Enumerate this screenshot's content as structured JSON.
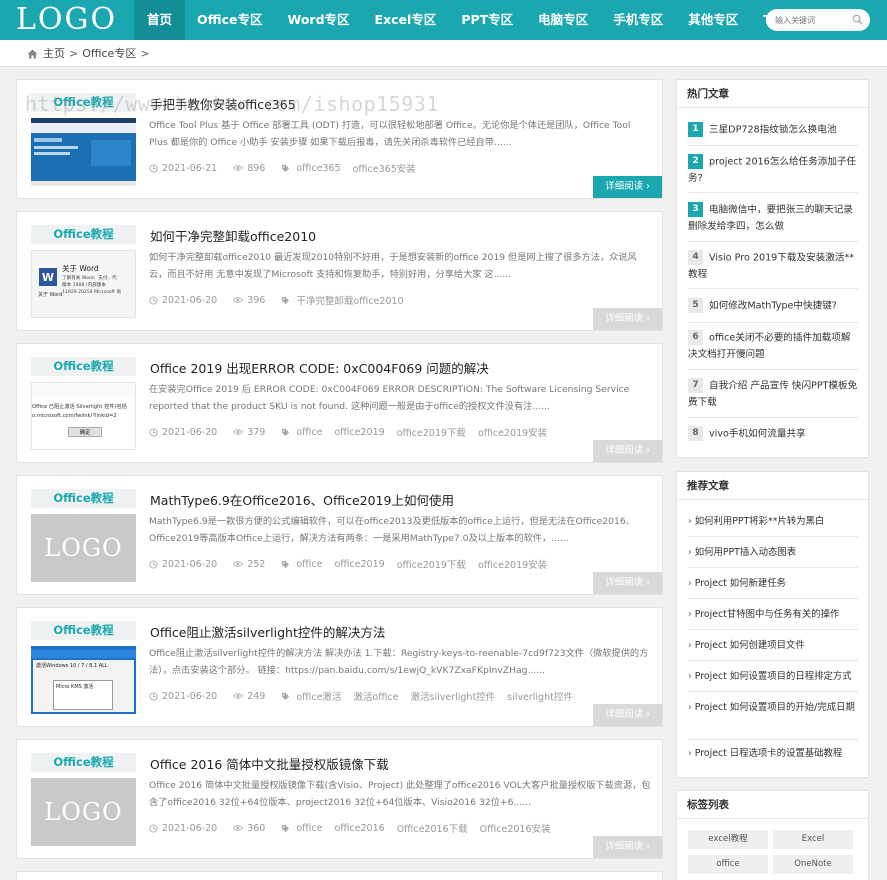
{
  "nav": {
    "logo": "LOGO",
    "items": [
      "首页",
      "Office专区",
      "Word专区",
      "Excel专区",
      "PPT专区",
      "电脑专区",
      "手机专区",
      "其他专区",
      "Tag标签"
    ],
    "search_placeholder": "输入关键词"
  },
  "breadcrumb": {
    "home": "主页",
    "sep": ">",
    "current": "Office专区"
  },
  "watermark": "https://www.huzhan.com/ishop15931",
  "articles": [
    {
      "category": "Office教程",
      "title": "手把手教你安装office365",
      "excerpt": "Office Tool Plus 基于 Office 部署工具 (ODT) 打造，可以很轻松地部署 Office。无论你是个体还是团队，Office Tool Plus 都是你的 Office 小助手 安装步骤 如果下载后报毒，请先关闭杀毒软件已经自带......",
      "date": "2021-06-21",
      "views": "896",
      "tags": [
        "office365",
        "office365安装"
      ],
      "more": "详细阅读"
    },
    {
      "category": "Office教程",
      "title": "如何干净完整卸载office2010",
      "excerpt": "如何干净完整卸载office2010 最近发现2010特别不好用，于是想安装新的office 2019 但是网上搜了很多方法，众说风云，而且不好用 无意中发现了Microsoft 支持和恢复助手，特别好用，分享给大家 这......",
      "date": "2021-06-20",
      "views": "396",
      "tags": [
        "干净完整卸载office2010"
      ],
      "more": "详细阅读",
      "thumb_title": "关于 Word",
      "thumb_lines": [
        "了解有关 Word、支付、代",
        "版本 1908 (内部版本",
        "11929.20254 Microsoft 商"
      ],
      "thumb_caption": "关于 Word"
    },
    {
      "category": "Office教程",
      "title": "Office 2019 出现ERROR CODE: 0xC004F069 问题的解决",
      "excerpt": "在安装完Office 2019 后 ERROR CODE: 0xC004F069 ERROR DESCRIPTION: The Software Licensing Service reported that the product SKU is not found. 这种问题一般是由于office的授权文件没有注......",
      "date": "2021-06-20",
      "views": "379",
      "tags": [
        "office",
        "office2019",
        "office2019下载",
        "office2019安装"
      ],
      "more": "详细阅读",
      "thumb_lines": [
        "Office 已阻止激活 Silverlight 控件(包括",
        "o.microsoft.com/fwlink/?linkid=2"
      ],
      "thumb_button": "确定"
    },
    {
      "category": "Office教程",
      "title": "MathType6.9在Office2016、Office2019上如何使用",
      "excerpt": "MathType6.9是一款很方便的公式编辑软件，可以在office2013及更低版本的office上运行，但是无法在Office2016、Office2019等高版本Office上运行，解决方法有两条：一是采用MathType7.0及以上版本的软件，......",
      "date": "2021-06-20",
      "views": "252",
      "tags": [
        "office",
        "office2019",
        "office2019下载",
        "office2019安装"
      ],
      "more": "详细阅读",
      "thumb_logo": "LOGO"
    },
    {
      "category": "Office教程",
      "title": "Office阻止激活silverlight控件的解决方法",
      "excerpt": "Office阻止激活silverlight控件的解决方法 解决办法 1.下载：Registry-keys-to-reenable-7cd9f723文件（微软提供的方法），点击安装这个部分。 链接：https://pan.baidu.com/s/1ewjQ_kVK7ZxaFKpInvZHag......",
      "date": "2021-06-20",
      "views": "249",
      "tags": [
        "office激活",
        "激活office",
        "激活silverlight控件",
        "silverlight控件"
      ],
      "more": "详细阅读",
      "thumb_lines": [
        "激活Windows 10 / 7 / 8.1 ALL",
        "Micro KMS 激活"
      ]
    },
    {
      "category": "Office教程",
      "title": "Office 2016 简体中文批量授权版镜像下载",
      "excerpt": "Office 2016 简体中文批量授权版镜像下载(含Visio、Project) 此处整理了office2016 VOL大客户批量授权版下载资源，包含了office2016 32位+64位版本、project2016 32位+64位版本、Visio2016 32位+6......",
      "date": "2021-06-20",
      "views": "360",
      "tags": [
        "office",
        "office2016",
        "Office2016下载",
        "Office2016安装"
      ],
      "more": "详细阅读",
      "thumb_logo": "LOGO"
    }
  ],
  "sidebar": {
    "hot_title": "热门文章",
    "hot": [
      {
        "n": "1",
        "t": "三星DP728指纹锁怎么换电池"
      },
      {
        "n": "2",
        "t": "project 2016怎么给任务添加子任务?"
      },
      {
        "n": "3",
        "t": "电脑微信中，要把张三的聊天记录删除发给李四，怎么做"
      },
      {
        "n": "4",
        "t": "Visio Pro 2019下载及安装激活**教程"
      },
      {
        "n": "5",
        "t": "如何修改MathType中快捷键?"
      },
      {
        "n": "6",
        "t": "office关闭不必要的插件加载项解决文档打开慢问题"
      },
      {
        "n": "7",
        "t": "自我介绍 产品宣传 快闪PPT模板免费下载"
      },
      {
        "n": "8",
        "t": "vivo手机如何流量共享"
      }
    ],
    "rec_title": "推荐文章",
    "rec": [
      "如何利用PPT将彩**片转为黑白",
      "如何用PPT插入动态图表",
      "Project 如何新建任务",
      "Project甘特图中与任务有关的操作",
      "Project 如何创建项目文件",
      "Project 如何设置项目的日程排定方式",
      "Project 如何设置项目的开始/完成日期",
      "Project 日程选项卡的设置基础教程"
    ],
    "tags_title": "标签列表",
    "tags": [
      "excel教程",
      "Excel",
      "office",
      "OneNote"
    ]
  },
  "colors": {
    "brand": "#1ba7b0",
    "brand_dark": "#148e96"
  }
}
